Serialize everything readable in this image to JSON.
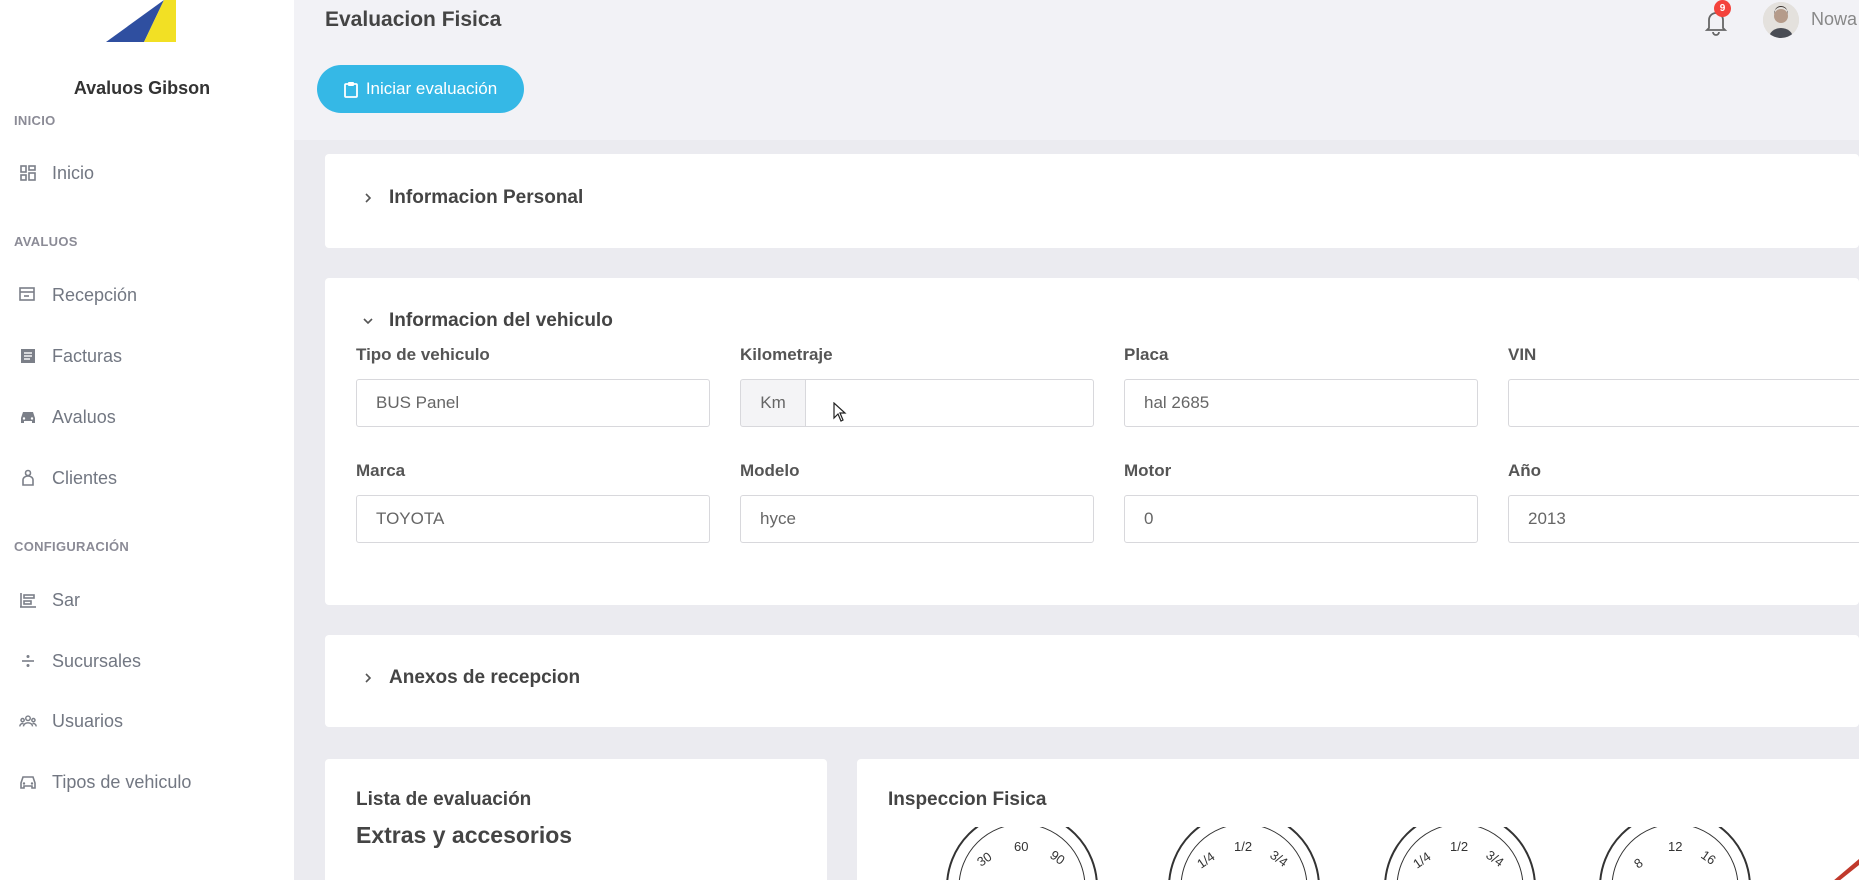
{
  "app": {
    "brand": "Avaluos Gibson",
    "page_title": "Evaluacion Fisica",
    "notifications_count": "9",
    "username": "Nowa"
  },
  "sidebar": {
    "sections": [
      {
        "label": "INICIO"
      },
      {
        "label": "AVALUOS"
      },
      {
        "label": "CONFIGURACIÓN"
      }
    ],
    "items": [
      {
        "label": "Inicio",
        "icon": "dashboard-icon"
      },
      {
        "label": "Recepción",
        "icon": "reception-icon"
      },
      {
        "label": "Facturas",
        "icon": "invoice-icon"
      },
      {
        "label": "Avaluos",
        "icon": "car-icon"
      },
      {
        "label": "Clientes",
        "icon": "client-icon"
      },
      {
        "label": "Sar",
        "icon": "sar-icon"
      },
      {
        "label": "Sucursales",
        "icon": "divide-icon"
      },
      {
        "label": "Usuarios",
        "icon": "users-icon"
      },
      {
        "label": "Tipos de vehiculo",
        "icon": "vehicle-icon"
      }
    ]
  },
  "actions": {
    "start_label": "Iniciar evaluación"
  },
  "sections": {
    "personal": "Informacion Personal",
    "vehicle": "Informacion del vehiculo",
    "annexes": "Anexos de recepcion"
  },
  "vehicle_form": {
    "tipo": {
      "label": "Tipo de vehiculo",
      "value": "BUS Panel"
    },
    "km": {
      "label": "Kilometraje",
      "addon": "Km",
      "value": ""
    },
    "placa": {
      "label": "Placa",
      "value": "hal 2685"
    },
    "vin": {
      "label": "VIN",
      "value": ""
    },
    "marca": {
      "label": "Marca",
      "value": "TOYOTA"
    },
    "modelo": {
      "label": "Modelo",
      "value": "hyce"
    },
    "motor": {
      "label": "Motor",
      "value": "0"
    },
    "anio": {
      "label": "Año",
      "value": "2013"
    }
  },
  "evaluation": {
    "list_title": "Lista de evaluación",
    "extras_title": "Extras y accesorios"
  },
  "inspection": {
    "title": "Inspeccion Fisica",
    "gauges": [
      {
        "ticks": [
          "30",
          "60",
          "90"
        ]
      },
      {
        "ticks": [
          "1/4",
          "1/2",
          "3/4"
        ]
      },
      {
        "ticks": [
          "1/4",
          "1/2",
          "3/4"
        ]
      },
      {
        "ticks": [
          "8",
          "12",
          "16"
        ]
      }
    ]
  },
  "colors": {
    "accent": "#35b8e6",
    "badge": "#f4433c",
    "logo_blue": "#2f4fa0",
    "logo_yellow": "#f2e024"
  }
}
